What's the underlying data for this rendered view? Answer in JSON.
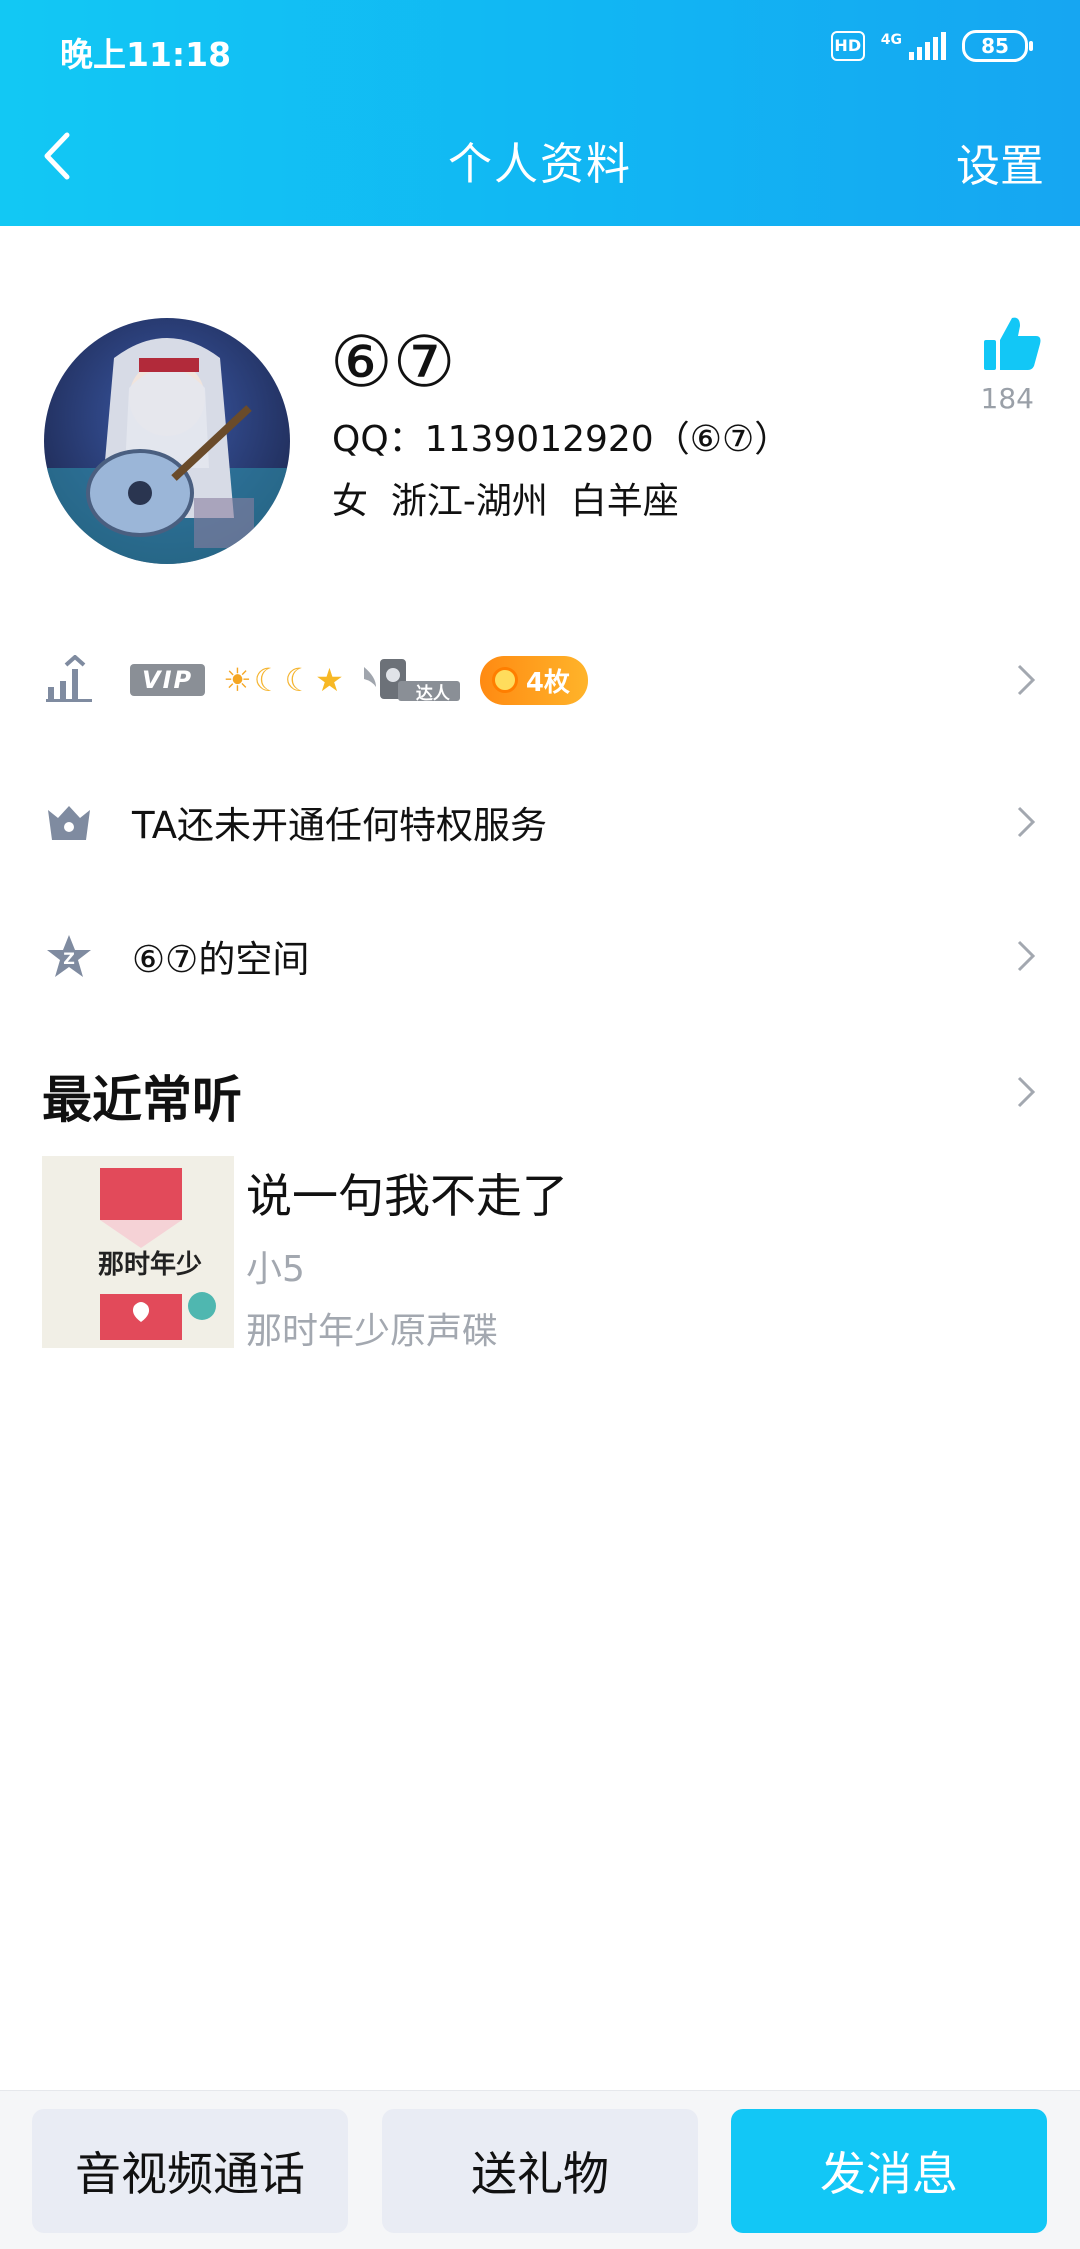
{
  "status_bar": {
    "time": "晚上11:18",
    "hd": "HD",
    "network": "4G",
    "battery": "85"
  },
  "nav": {
    "title": "个人资料",
    "settings_label": "设置"
  },
  "profile": {
    "nickname": "⑥⑦",
    "qq_line": "QQ：1139012920（⑥⑦）",
    "info_line": "女  浙江-湖州  白羊座",
    "like_count": "184"
  },
  "badges": {
    "vip_label": "VIP",
    "daren_label": "达人",
    "medal_label": "4枚"
  },
  "rows": {
    "privilege_text": "TA还未开通任何特权服务",
    "space_text": "⑥⑦的空间"
  },
  "recent": {
    "title": "最近常听",
    "song_title": "说一句我不走了",
    "artist": "小5",
    "album": "那时年少原声碟",
    "cover_text": "那时年少"
  },
  "bottom": {
    "call_label": "音视频通话",
    "gift_label": "送礼物",
    "message_label": "发消息"
  },
  "colors": {
    "accent": "#12c7f6",
    "muted": "#a3a8b0"
  }
}
